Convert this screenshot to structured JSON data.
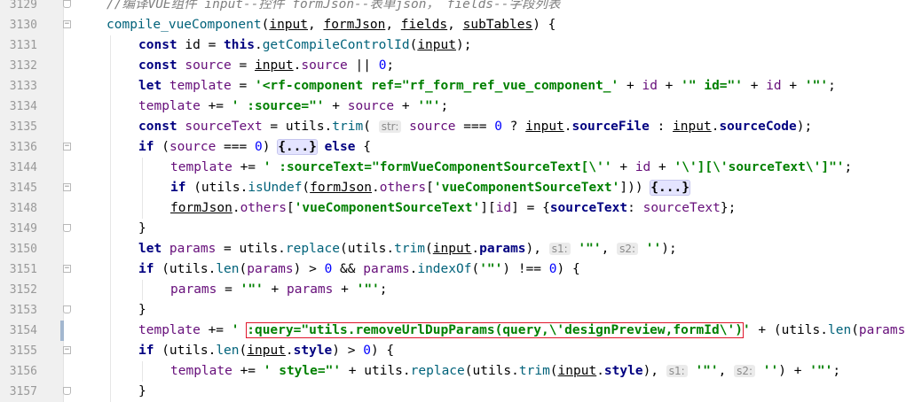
{
  "editor": {
    "lines": [
      {
        "n": "3129",
        "indent": 0,
        "fold": "end",
        "tokens": [
          [
            "cm",
            "//编译VUE组件 input--控件 formJson--表单json， fields--字段列表"
          ]
        ]
      },
      {
        "n": "3130",
        "indent": 0,
        "fold": "start",
        "tokens": [
          [
            "fn",
            "compile_vueComponent"
          ],
          [
            "pl",
            "("
          ],
          [
            "pl u",
            "input"
          ],
          [
            "pl",
            ", "
          ],
          [
            "pl u",
            "formJson"
          ],
          [
            "pl",
            ", "
          ],
          [
            "pl u",
            "fields"
          ],
          [
            "pl",
            ", "
          ],
          [
            "pl u",
            "subTables"
          ],
          [
            "pl",
            ") {"
          ]
        ]
      },
      {
        "n": "3131",
        "indent": 1,
        "tokens": [
          [
            "kw",
            "const "
          ],
          [
            "pl",
            "id = "
          ],
          [
            "kw",
            "this"
          ],
          [
            "pl",
            "."
          ],
          [
            "fn",
            "getCompileControlId"
          ],
          [
            "pl",
            "("
          ],
          [
            "pl u",
            "input"
          ],
          [
            "pl",
            ");"
          ]
        ]
      },
      {
        "n": "3132",
        "indent": 1,
        "tokens": [
          [
            "kw",
            "const "
          ],
          [
            "pr",
            "source"
          ],
          [
            "pl",
            " = "
          ],
          [
            "pl u",
            "input"
          ],
          [
            "pl",
            "."
          ],
          [
            "pr",
            "source"
          ],
          [
            "pl",
            " || "
          ],
          [
            "nm",
            "0"
          ],
          [
            "pl",
            ";"
          ]
        ]
      },
      {
        "n": "3133",
        "indent": 1,
        "tokens": [
          [
            "kw",
            "let "
          ],
          [
            "pr",
            "template"
          ],
          [
            "pl",
            " = "
          ],
          [
            "st",
            "'<rf-component ref=\"rf_form_ref_vue_component_'"
          ],
          [
            "pl",
            " + "
          ],
          [
            "pr",
            "id"
          ],
          [
            "pl",
            " + "
          ],
          [
            "st",
            "'\" id=\"'"
          ],
          [
            "pl",
            " + "
          ],
          [
            "pr",
            "id"
          ],
          [
            "pl",
            " + "
          ],
          [
            "st",
            "'\"'"
          ],
          [
            "pl",
            ";"
          ]
        ]
      },
      {
        "n": "3134",
        "indent": 1,
        "tokens": [
          [
            "pr",
            "template"
          ],
          [
            "pl",
            " += "
          ],
          [
            "st",
            "' :source=\"'"
          ],
          [
            "pl",
            " + "
          ],
          [
            "pr",
            "source"
          ],
          [
            "pl",
            " + "
          ],
          [
            "st",
            "'\"'"
          ],
          [
            "pl",
            ";"
          ]
        ]
      },
      {
        "n": "3135",
        "indent": 1,
        "tokens": [
          [
            "kw",
            "const "
          ],
          [
            "pr",
            "sourceText"
          ],
          [
            "pl",
            " = "
          ],
          [
            "pl",
            "utils."
          ],
          [
            "fn",
            "trim"
          ],
          [
            "pl",
            "( "
          ],
          [
            "hint",
            "str:"
          ],
          [
            "pl",
            " "
          ],
          [
            "pr",
            "source"
          ],
          [
            "pl",
            " === "
          ],
          [
            "nm",
            "0"
          ],
          [
            "pl",
            " ? "
          ],
          [
            "pl u",
            "input"
          ],
          [
            "pl",
            "."
          ],
          [
            "kw",
            "sourceFile"
          ],
          [
            "pl",
            " : "
          ],
          [
            "pl u",
            "input"
          ],
          [
            "pl",
            "."
          ],
          [
            "kw",
            "sourceCode"
          ],
          [
            "pl",
            ");"
          ]
        ]
      },
      {
        "n": "3136",
        "indent": 1,
        "fold": "start",
        "tokens": [
          [
            "kw",
            "if "
          ],
          [
            "pl",
            "("
          ],
          [
            "pr",
            "source"
          ],
          [
            "pl",
            " === "
          ],
          [
            "nm",
            "0"
          ],
          [
            "pl",
            ") "
          ],
          [
            "folded",
            "{...}"
          ],
          [
            "pl",
            " "
          ],
          [
            "kw",
            "else "
          ],
          [
            "pl",
            "{"
          ]
        ]
      },
      {
        "n": "3144",
        "indent": 2,
        "tokens": [
          [
            "pr",
            "template"
          ],
          [
            "pl",
            " += "
          ],
          [
            "st",
            "' :sourceText=\"formVueComponentSourceText[\\''"
          ],
          [
            "pl",
            " + "
          ],
          [
            "pr",
            "id"
          ],
          [
            "pl",
            " + "
          ],
          [
            "st",
            "'\\'][\\'sourceText\\']\"'"
          ],
          [
            "pl",
            ";"
          ]
        ]
      },
      {
        "n": "3145",
        "indent": 2,
        "fold": "start",
        "tokens": [
          [
            "kw",
            "if "
          ],
          [
            "pl",
            "(utils."
          ],
          [
            "fn",
            "isUndef"
          ],
          [
            "pl",
            "("
          ],
          [
            "pl u",
            "formJson"
          ],
          [
            "pl",
            "."
          ],
          [
            "pr",
            "others"
          ],
          [
            "pl",
            "["
          ],
          [
            "st",
            "'vueComponentSourceText'"
          ],
          [
            "pl",
            "])) "
          ],
          [
            "folded",
            "{...}"
          ]
        ]
      },
      {
        "n": "3148",
        "indent": 2,
        "tokens": [
          [
            "pl u",
            "formJson"
          ],
          [
            "pl",
            "."
          ],
          [
            "pr",
            "others"
          ],
          [
            "pl",
            "["
          ],
          [
            "st",
            "'vueComponentSourceText'"
          ],
          [
            "pl",
            "]["
          ],
          [
            "pr",
            "id"
          ],
          [
            "pl",
            "] = {"
          ],
          [
            "kw",
            "sourceText"
          ],
          [
            "pl",
            ": "
          ],
          [
            "pr",
            "sourceText"
          ],
          [
            "pl",
            "};"
          ]
        ]
      },
      {
        "n": "3149",
        "indent": 1,
        "fold": "end",
        "tokens": [
          [
            "pl",
            "}"
          ]
        ]
      },
      {
        "n": "3150",
        "indent": 1,
        "tokens": [
          [
            "kw",
            "let "
          ],
          [
            "pr",
            "params"
          ],
          [
            "pl",
            " = utils."
          ],
          [
            "fn",
            "replace"
          ],
          [
            "pl",
            "(utils."
          ],
          [
            "fn",
            "trim"
          ],
          [
            "pl",
            "("
          ],
          [
            "pl u",
            "input"
          ],
          [
            "pl",
            "."
          ],
          [
            "kw",
            "params"
          ],
          [
            "pl",
            "), "
          ],
          [
            "hint",
            "s1:"
          ],
          [
            "pl",
            " "
          ],
          [
            "st",
            "'\"'"
          ],
          [
            "pl",
            ", "
          ],
          [
            "hint",
            "s2:"
          ],
          [
            "pl",
            " "
          ],
          [
            "st",
            "''"
          ],
          [
            "pl",
            ");"
          ]
        ]
      },
      {
        "n": "3151",
        "indent": 1,
        "fold": "start",
        "tokens": [
          [
            "kw",
            "if "
          ],
          [
            "pl",
            "(utils."
          ],
          [
            "fn",
            "len"
          ],
          [
            "pl",
            "("
          ],
          [
            "pr",
            "params"
          ],
          [
            "pl",
            ") > "
          ],
          [
            "nm",
            "0"
          ],
          [
            "pl",
            " && "
          ],
          [
            "pr",
            "params"
          ],
          [
            "pl",
            "."
          ],
          [
            "fn",
            "indexOf"
          ],
          [
            "pl",
            "("
          ],
          [
            "st",
            "'\"'"
          ],
          [
            "pl",
            ") !== "
          ],
          [
            "nm",
            "0"
          ],
          [
            "pl",
            ") {"
          ]
        ]
      },
      {
        "n": "3152",
        "indent": 2,
        "tokens": [
          [
            "pr",
            "params"
          ],
          [
            "pl",
            " = "
          ],
          [
            "st",
            "'\"'"
          ],
          [
            "pl",
            " + "
          ],
          [
            "pr",
            "params"
          ],
          [
            "pl",
            " + "
          ],
          [
            "st",
            "'\"'"
          ],
          [
            "pl",
            ";"
          ]
        ]
      },
      {
        "n": "3153",
        "indent": 1,
        "fold": "end",
        "tokens": [
          [
            "pl",
            "}"
          ]
        ]
      },
      {
        "n": "3154",
        "indent": 1,
        "marker": true,
        "tokens": [
          [
            "pr",
            "template"
          ],
          [
            "pl",
            " += "
          ],
          [
            "st",
            "' "
          ],
          [
            "st hl",
            ":query=\"utils.removeUrlDupParams(query,\\'designPreview,formId\\')"
          ],
          [
            "st",
            "'"
          ],
          [
            "pl",
            " + (utils."
          ],
          [
            "fn",
            "len"
          ],
          [
            "pl",
            "("
          ],
          [
            "pr",
            "params"
          ]
        ]
      },
      {
        "n": "3155",
        "indent": 1,
        "fold": "start",
        "tokens": [
          [
            "kw",
            "if "
          ],
          [
            "pl",
            "(utils."
          ],
          [
            "fn",
            "len"
          ],
          [
            "pl",
            "("
          ],
          [
            "pl u",
            "input"
          ],
          [
            "pl",
            "."
          ],
          [
            "kw",
            "style"
          ],
          [
            "pl",
            ") > "
          ],
          [
            "nm",
            "0"
          ],
          [
            "pl",
            ") {"
          ]
        ]
      },
      {
        "n": "3156",
        "indent": 2,
        "tokens": [
          [
            "pr",
            "template"
          ],
          [
            "pl",
            " += "
          ],
          [
            "st",
            "' style=\"'"
          ],
          [
            "pl",
            " + utils."
          ],
          [
            "fn",
            "replace"
          ],
          [
            "pl",
            "(utils."
          ],
          [
            "fn",
            "trim"
          ],
          [
            "pl",
            "("
          ],
          [
            "pl u",
            "input"
          ],
          [
            "pl",
            "."
          ],
          [
            "kw",
            "style"
          ],
          [
            "pl",
            "), "
          ],
          [
            "hint",
            "s1:"
          ],
          [
            "pl",
            " "
          ],
          [
            "st",
            "'\"'"
          ],
          [
            "pl",
            ", "
          ],
          [
            "hint",
            "s2:"
          ],
          [
            "pl",
            " "
          ],
          [
            "st",
            "''"
          ],
          [
            "pl",
            ") + "
          ],
          [
            "st",
            "'\"'"
          ],
          [
            "pl",
            ";"
          ]
        ]
      },
      {
        "n": "3157",
        "indent": 1,
        "fold": "end",
        "tokens": [
          [
            "pl",
            "}"
          ]
        ]
      }
    ]
  }
}
